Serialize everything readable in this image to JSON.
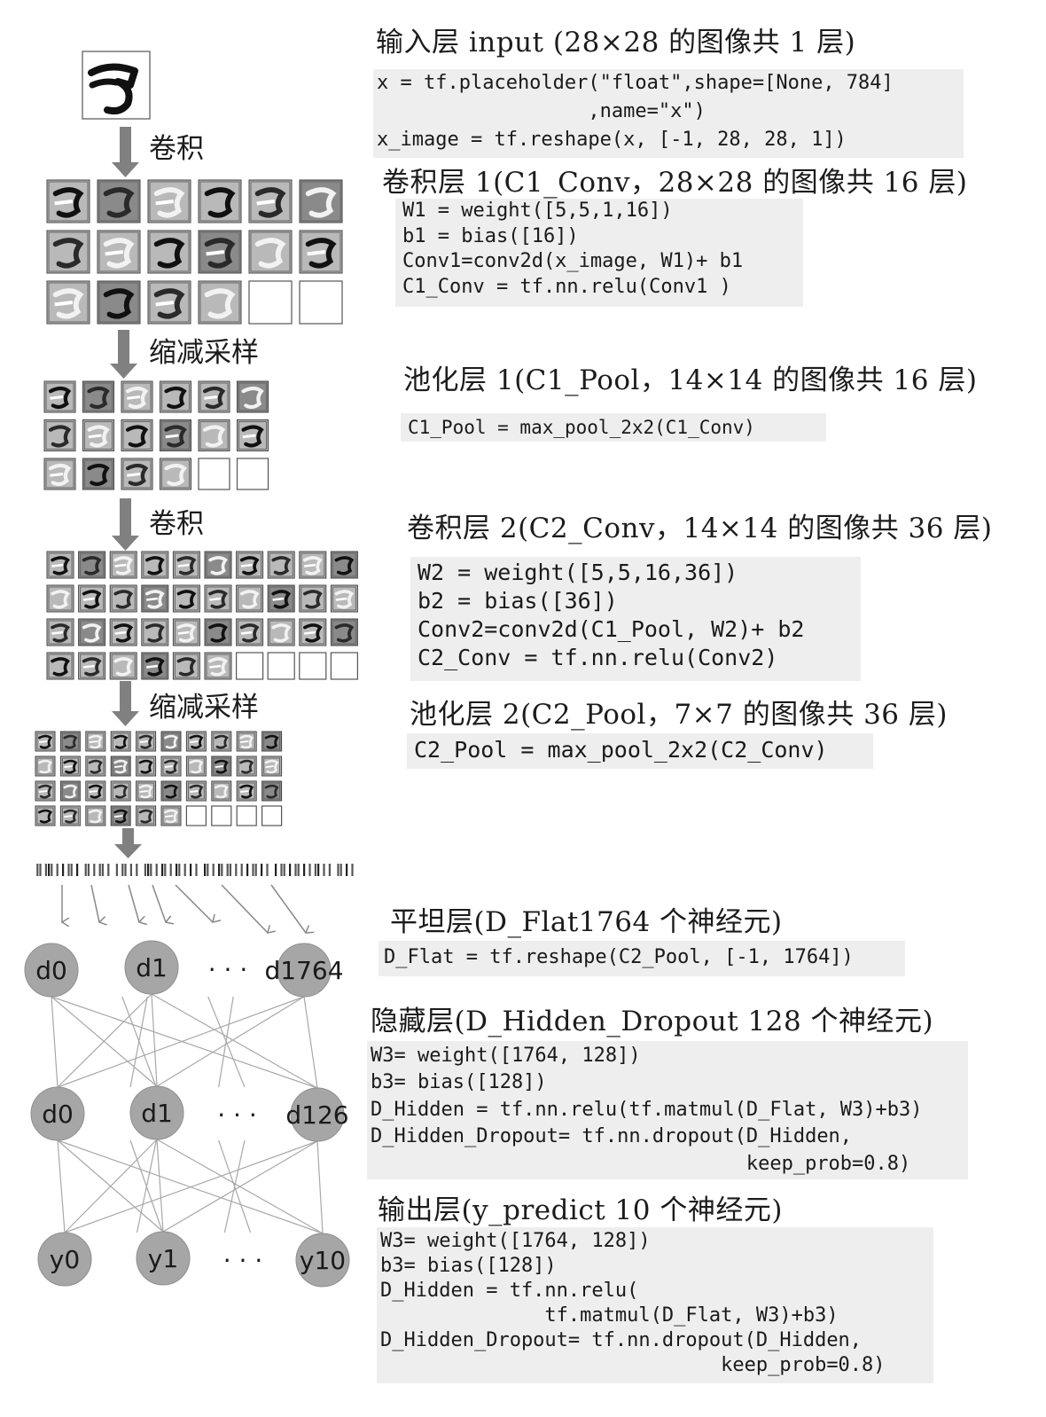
{
  "left": {
    "steps": [
      "卷积",
      "缩减采样",
      "卷积",
      "缩减采样"
    ],
    "layer_a": [
      "d0",
      "d1",
      "d1764"
    ],
    "layer_b": [
      "d0",
      "d1",
      "d126"
    ],
    "layer_c": [
      "y0",
      "y1",
      "y10"
    ],
    "ellipsis": "· · ·"
  },
  "input": {
    "heading": "输入层 input (28×28 的图像共 1 层)",
    "code": [
      "x = tf.placeholder(\"float\",shape=[None, 784]",
      "                  ,name=\"x\")",
      "x_image = tf.reshape(x, [-1, 28, 28, 1])"
    ]
  },
  "conv1": {
    "heading": "卷积层 1(C1_Conv，28×28 的图像共 16 层)",
    "code": [
      "W1 = weight([5,5,1,16])",
      "b1 = bias([16])",
      "Conv1=conv2d(x_image, W1)+ b1",
      "C1_Conv = tf.nn.relu(Conv1 )"
    ]
  },
  "pool1": {
    "heading": "池化层 1(C1_Pool，14×14 的图像共 16 层)",
    "code": [
      "C1_Pool = max_pool_2x2(C1_Conv)"
    ]
  },
  "conv2": {
    "heading": "卷积层 2(C2_Conv，14×14 的图像共 36 层)",
    "code": [
      "W2 = weight([5,5,16,36])",
      "b2 = bias([36])",
      "Conv2=conv2d(C1_Pool, W2)+ b2",
      "C2_Conv = tf.nn.relu(Conv2)"
    ]
  },
  "pool2": {
    "heading": "池化层 2(C2_Pool，7×7 的图像共 36 层)",
    "code": [
      "C2_Pool = max_pool_2x2(C2_Conv)"
    ]
  },
  "flat": {
    "heading": "平坦层(D_Flat1764 个神经元)",
    "code": [
      "D_Flat = tf.reshape(C2_Pool, [-1, 1764])"
    ]
  },
  "hidden": {
    "heading": "隐藏层(D_Hidden_Dropout  128 个神经元)",
    "code": [
      "W3= weight([1764, 128])",
      "b3= bias([128])",
      "D_Hidden = tf.nn.relu(tf.matmul(D_Flat, W3)+b3)",
      "D_Hidden_Dropout= tf.nn.dropout(D_Hidden,",
      "                                keep_prob=0.8)"
    ]
  },
  "output": {
    "heading": "输出层(y_predict  10 个神经元)",
    "code": [
      "W3= weight([1764, 128])",
      "b3= bias([128])",
      "D_Hidden = tf.nn.relu(",
      "              tf.matmul(D_Flat, W3)+b3)",
      "D_Hidden_Dropout= tf.nn.dropout(D_Hidden,",
      "                             keep_prob=0.8)"
    ]
  }
}
